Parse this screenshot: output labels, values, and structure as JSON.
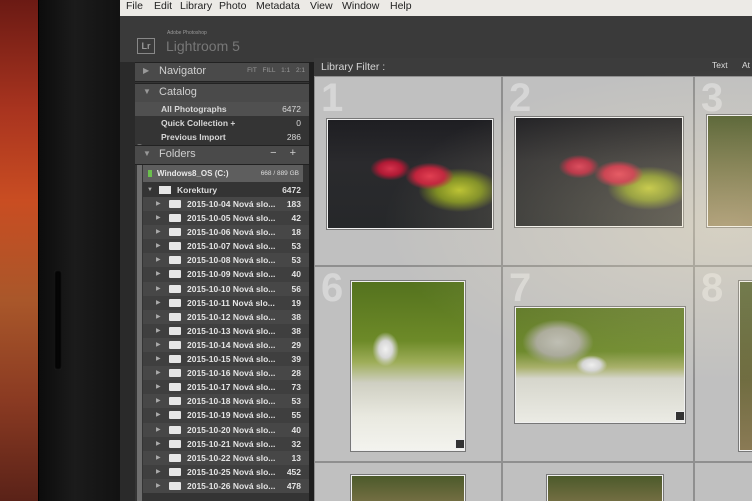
{
  "menu": [
    "File",
    "Edit",
    "Library",
    "Photo",
    "Metadata",
    "View",
    "Window",
    "Help"
  ],
  "app": {
    "logo": "Lr",
    "subtitle": "Adobe Photoshop",
    "name": "Lightroom 5"
  },
  "navigator": {
    "title": "Navigator",
    "options": [
      "FIT",
      "FILL",
      "1:1",
      "2:1"
    ]
  },
  "catalog": {
    "title": "Catalog",
    "items": [
      {
        "label": "All Photographs",
        "count": "6472"
      },
      {
        "label": "Quick Collection +",
        "count": "0"
      },
      {
        "label": "Previous Import",
        "count": "286"
      }
    ]
  },
  "folders": {
    "title": "Folders",
    "actions": "− +",
    "volume": {
      "name": "Windows8_OS (C:)",
      "size": "668 / 889 GB"
    },
    "root": {
      "name": "Korektury",
      "count": "6472"
    },
    "items": [
      {
        "name": "2015-10-04 Nová slo...",
        "count": "183"
      },
      {
        "name": "2015-10-05 Nová slo...",
        "count": "42"
      },
      {
        "name": "2015-10-06 Nová slo...",
        "count": "18"
      },
      {
        "name": "2015-10-07 Nová slo...",
        "count": "53"
      },
      {
        "name": "2015-10-08 Nová slo...",
        "count": "53"
      },
      {
        "name": "2015-10-09 Nová slo...",
        "count": "40"
      },
      {
        "name": "2015-10-10 Nová slo...",
        "count": "56"
      },
      {
        "name": "2015-10-11 Nová slo...",
        "count": "19"
      },
      {
        "name": "2015-10-12 Nová slo...",
        "count": "38"
      },
      {
        "name": "2015-10-13 Nová slo...",
        "count": "38"
      },
      {
        "name": "2015-10-14 Nová slo...",
        "count": "29"
      },
      {
        "name": "2015-10-15 Nová slo...",
        "count": "39"
      },
      {
        "name": "2015-10-16 Nová slo...",
        "count": "28"
      },
      {
        "name": "2015-10-17 Nová slo...",
        "count": "73"
      },
      {
        "name": "2015-10-18 Nová slo...",
        "count": "53"
      },
      {
        "name": "2015-10-19 Nová slo...",
        "count": "55"
      },
      {
        "name": "2015-10-20 Nová slo...",
        "count": "40"
      },
      {
        "name": "2015-10-21 Nová slo...",
        "count": "32"
      },
      {
        "name": "2015-10-22 Nová slo...",
        "count": "13"
      },
      {
        "name": "2015-10-25 Nová slo...",
        "count": "452"
      },
      {
        "name": "2015-10-26 Nová slo...",
        "count": "478"
      }
    ]
  },
  "filter": {
    "label": "Library Filter :",
    "text": "Text",
    "attribute": "At"
  },
  "grid": {
    "cell_numbers": [
      "1",
      "2",
      "3",
      "6",
      "7",
      "8"
    ]
  }
}
